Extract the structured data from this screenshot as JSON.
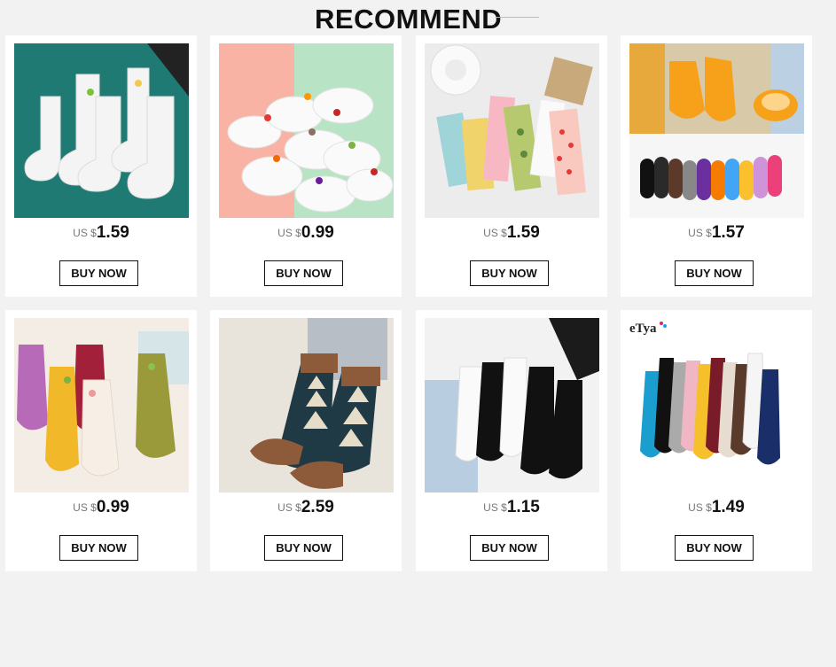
{
  "page": {
    "section_title": "RECOMMEND"
  },
  "products": [
    {
      "image": "white-crew-socks-on-teal-cloth",
      "currency": "US $",
      "price": "1.59",
      "button": "BUY NOW"
    },
    {
      "image": "white-fruit-embroidered-ankle-socks",
      "currency": "US $",
      "price": "0.99",
      "button": "BUY NOW"
    },
    {
      "image": "fruit-pattern-crew-socks",
      "currency": "US $",
      "price": "1.59",
      "button": "BUY NOW"
    },
    {
      "image": "colorful-floor-grip-socks",
      "currency": "US $",
      "price": "1.57",
      "button": "BUY NOW"
    },
    {
      "image": "fuzzy-fruit-embroidered-socks",
      "currency": "US $",
      "price": "0.99",
      "button": "BUY NOW"
    },
    {
      "image": "tree-pattern-wool-socks",
      "currency": "US $",
      "price": "2.59",
      "button": "BUY NOW"
    },
    {
      "image": "black-white-crew-socks",
      "currency": "US $",
      "price": "1.15",
      "button": "BUY NOW"
    },
    {
      "image": "ruffle-colored-socks",
      "currency": "US $",
      "price": "1.49",
      "button": "BUY NOW",
      "brand_logo": "eTya"
    }
  ],
  "colors": {
    "background": "#f2f2f2",
    "card": "#ffffff",
    "text": "#111111",
    "currency": "#777777"
  }
}
